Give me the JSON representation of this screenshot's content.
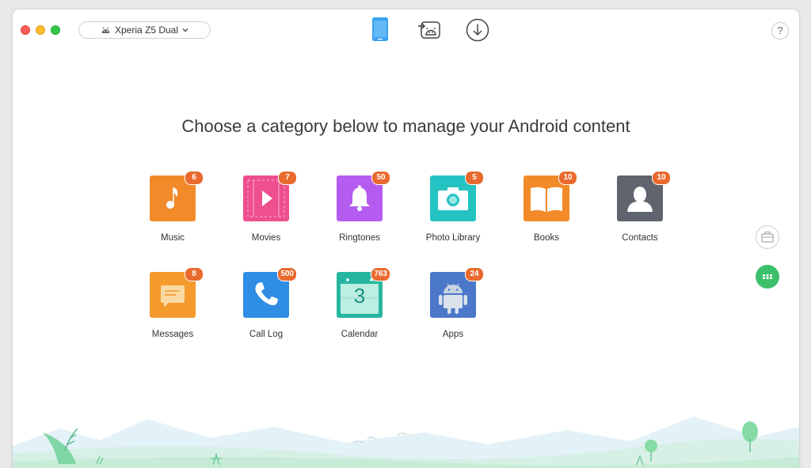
{
  "device": {
    "name": "Xperia Z5 Dual"
  },
  "toolbar": {
    "help_label": "?"
  },
  "main": {
    "heading": "Choose a category below to manage your Android content",
    "categories": [
      {
        "label": "Music",
        "count": "6",
        "icon": "music-note-icon",
        "color": "#f28a2a"
      },
      {
        "label": "Movies",
        "count": "7",
        "icon": "play-film-icon",
        "color": "#ee4f8e"
      },
      {
        "label": "Ringtones",
        "count": "50",
        "icon": "bell-icon",
        "color": "#b45bf0"
      },
      {
        "label": "Photo Library",
        "count": "5",
        "icon": "camera-icon",
        "color": "#24c3c2"
      },
      {
        "label": "Books",
        "count": "10",
        "icon": "open-book-icon",
        "color": "#f28a2a"
      },
      {
        "label": "Contacts",
        "count": "10",
        "icon": "person-silhouette-icon",
        "color": "#5f646e"
      },
      {
        "label": "Messages",
        "count": "8",
        "icon": "message-icon",
        "color": "#f59a2c"
      },
      {
        "label": "Call Log",
        "count": "500",
        "icon": "phone-handset-icon",
        "color": "#2f8de4"
      },
      {
        "label": "Calendar",
        "count": "763",
        "icon": "calendar-icon",
        "color": "#26b6a0"
      },
      {
        "label": "Apps",
        "count": "24",
        "icon": "android-robot-icon",
        "color": "#4b78c9"
      }
    ],
    "calendar_day": "3"
  },
  "colors": {
    "accent_green": "#3cc06b",
    "badge": "#e96a2e",
    "device_blue": "#3aa3f2"
  }
}
